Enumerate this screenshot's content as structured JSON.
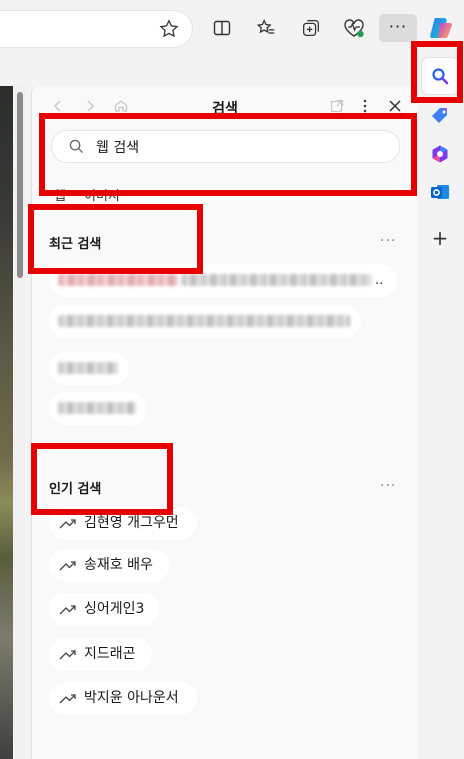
{
  "toolbar": {
    "more_label": "···",
    "icons": [
      "favorite-star-icon",
      "split-screen-icon",
      "favorites-icon",
      "collections-icon",
      "browser-essentials-icon",
      "more-icon",
      "copilot-icon"
    ]
  },
  "panel": {
    "title": "검색",
    "search": {
      "query": "웹 검색"
    },
    "tabs": [
      "웹",
      "이미지"
    ],
    "recent": {
      "title": "최근 검색",
      "more_label": "···",
      "ellipsis": ".."
    },
    "trending": {
      "title": "인기 검색",
      "more_label": "···",
      "items": [
        "김현영 개그우먼",
        "송재호 배우",
        "싱어게인3",
        "지드래곤",
        "박지윤 아나운서"
      ]
    }
  },
  "sidebar": {
    "items": [
      "search-icon",
      "tag-icon",
      "m365-icon",
      "outlook-icon",
      "add-icon"
    ],
    "add_label": "+"
  },
  "colors": {
    "annotation": "#e60000",
    "panel_bg": "#f9f9f9",
    "chip_bg": "#ffffff"
  }
}
